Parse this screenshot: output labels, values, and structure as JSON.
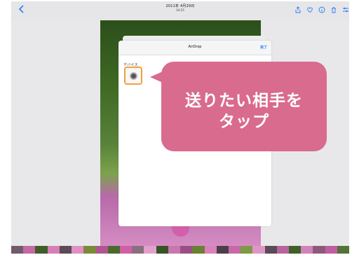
{
  "nav": {
    "date": "2011年 4月29日",
    "time": "14:15",
    "back_icon": "chevron-left-icon",
    "actions": [
      "share-icon",
      "heart-icon",
      "info-icon",
      "trash-icon",
      "sliders-icon"
    ]
  },
  "sheet": {
    "title": "AirDrop",
    "done_label": "完了",
    "section_label": "デバイス"
  },
  "callout": {
    "line1": "送りたい相手を",
    "line2": "タップ"
  },
  "colors": {
    "accent": "#2b7cf7",
    "callout": "#d96b8e",
    "highlight": "#f0a23a"
  },
  "thumbnails": [
    "#6f5b6a",
    "#c46aa4",
    "#3f5e2a",
    "#d67fb6",
    "#5a4b55",
    "#e090c2",
    "#7a8a3a",
    "#b05592",
    "#4a6a2c",
    "#d05fa6",
    "#8a6f7f",
    "#e4a0cc",
    "#365424",
    "#c976b0",
    "#9a4f83",
    "#6a8032",
    "#db7fbd",
    "#4d3f49",
    "#c66aa6",
    "#7c9b43",
    "#e095c7",
    "#5c4a58",
    "#b7659d",
    "#3f6029",
    "#d382ba",
    "#8d5a7c",
    "#c05e9f",
    "#527336"
  ]
}
